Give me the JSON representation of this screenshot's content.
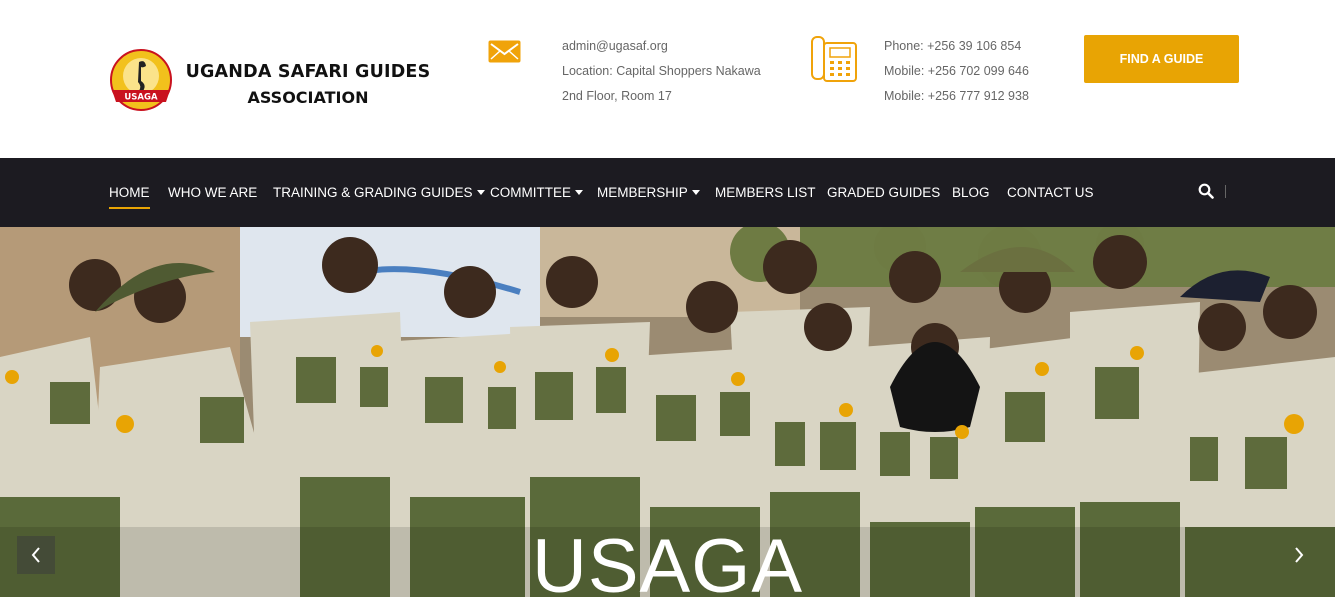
{
  "brand": {
    "line1": "UGANDA SAFARI GUIDES",
    "line2": "ASSOCIATION",
    "logo_badge": "USAGA"
  },
  "header": {
    "email": "admin@ugasaf.org",
    "location": "Location: Capital Shoppers Nakawa",
    "floor": "2nd Floor, Room 17",
    "phone": "Phone: +256 39 106 854",
    "mobile1": "Mobile: +256 702 099 646",
    "mobile2": "Mobile: +256 777 912 938",
    "cta_label": "FIND A GUIDE",
    "icons": {
      "mail": "envelope-icon",
      "phone": "telephone-icon"
    }
  },
  "nav": {
    "items": [
      {
        "label": "HOME",
        "active": true
      },
      {
        "label": "WHO WE ARE"
      },
      {
        "label": "TRAINING & GRADING GUIDES",
        "dropdown": true
      },
      {
        "label": "COMMITTEE",
        "dropdown": true
      },
      {
        "label": "MEMBERSHIP",
        "dropdown": true
      },
      {
        "label": "MEMBERS LIST"
      },
      {
        "label": "GRADED GUIDES"
      },
      {
        "label": "BLOG"
      },
      {
        "label": "CONTACT US"
      }
    ],
    "search_icon": "search-icon"
  },
  "hero": {
    "title": "USAGA"
  },
  "colors": {
    "accent": "#e8a404",
    "nav_bg": "#1c1b21",
    "uniform": "#d8d4c3",
    "uniform_pocket": "#5e6b3c"
  }
}
